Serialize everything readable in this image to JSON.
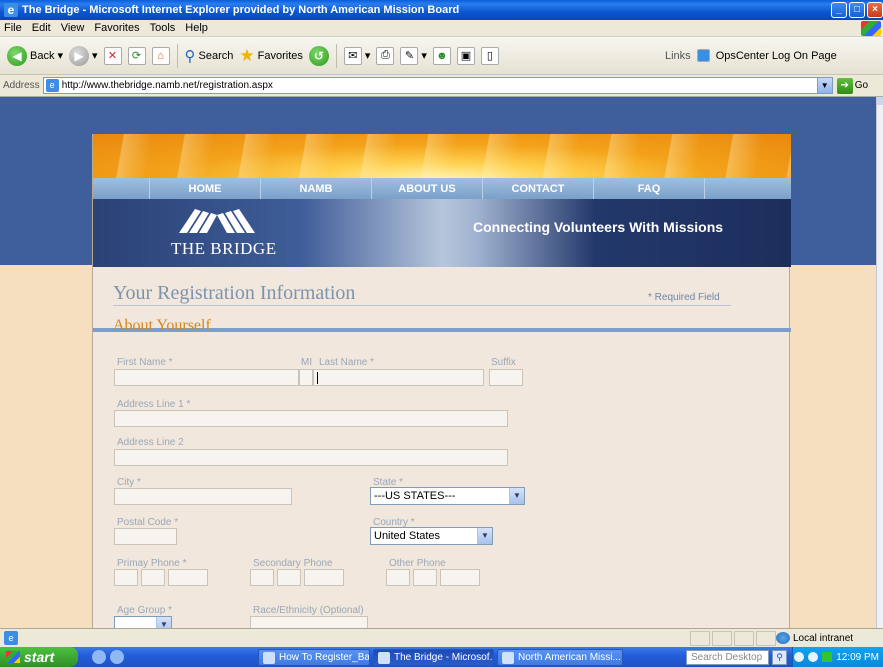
{
  "window": {
    "title": "The Bridge - Microsoft Internet Explorer provided by North American Mission Board",
    "controls": [
      "_",
      "□",
      "×"
    ]
  },
  "menu": [
    "File",
    "Edit",
    "View",
    "Favorites",
    "Tools",
    "Help"
  ],
  "toolbar": {
    "back_label": "Back",
    "search_label": "Search",
    "favorites_label": "Favorites",
    "links_label": "Links",
    "link_item": "OpsCenter Log On Page"
  },
  "address": {
    "label": "Address",
    "url": "http://www.thebridge.namb.net/registration.aspx",
    "go_label": "Go"
  },
  "site": {
    "nav": [
      "HOME",
      "NAMB",
      "ABOUT US",
      "CONTACT",
      "FAQ"
    ],
    "logo_text": "THE BRIDGE",
    "tagline": "Connecting Volunteers With Missions"
  },
  "form": {
    "title": "Your Registration Information",
    "required_note": "* Required Field",
    "section": "About Yourself",
    "labels": {
      "first_name": "First Name *",
      "mi": "MI",
      "last_name": "Last Name *",
      "suffix": "Suffix",
      "address1": "Address Line 1 *",
      "address2": "Address Line 2",
      "city": "City *",
      "state": "State *",
      "postal": "Postal Code *",
      "country": "Country *",
      "primary_phone": "Primay Phone *",
      "secondary_phone": "Secondary Phone",
      "other_phone": "Other Phone",
      "age_group": "Age Group *",
      "race": "Race/Ethnicity (Optional)"
    },
    "state_value": "---US STATES---",
    "country_value": "United States"
  },
  "status": {
    "zone": "Local intranet"
  },
  "taskbar": {
    "start": "start",
    "tasks": [
      "How To Register_Basi...",
      "The Bridge - Microsof...",
      "North American Missi..."
    ],
    "search_placeholder": "Search Desktop",
    "clock": "12:09 PM"
  }
}
